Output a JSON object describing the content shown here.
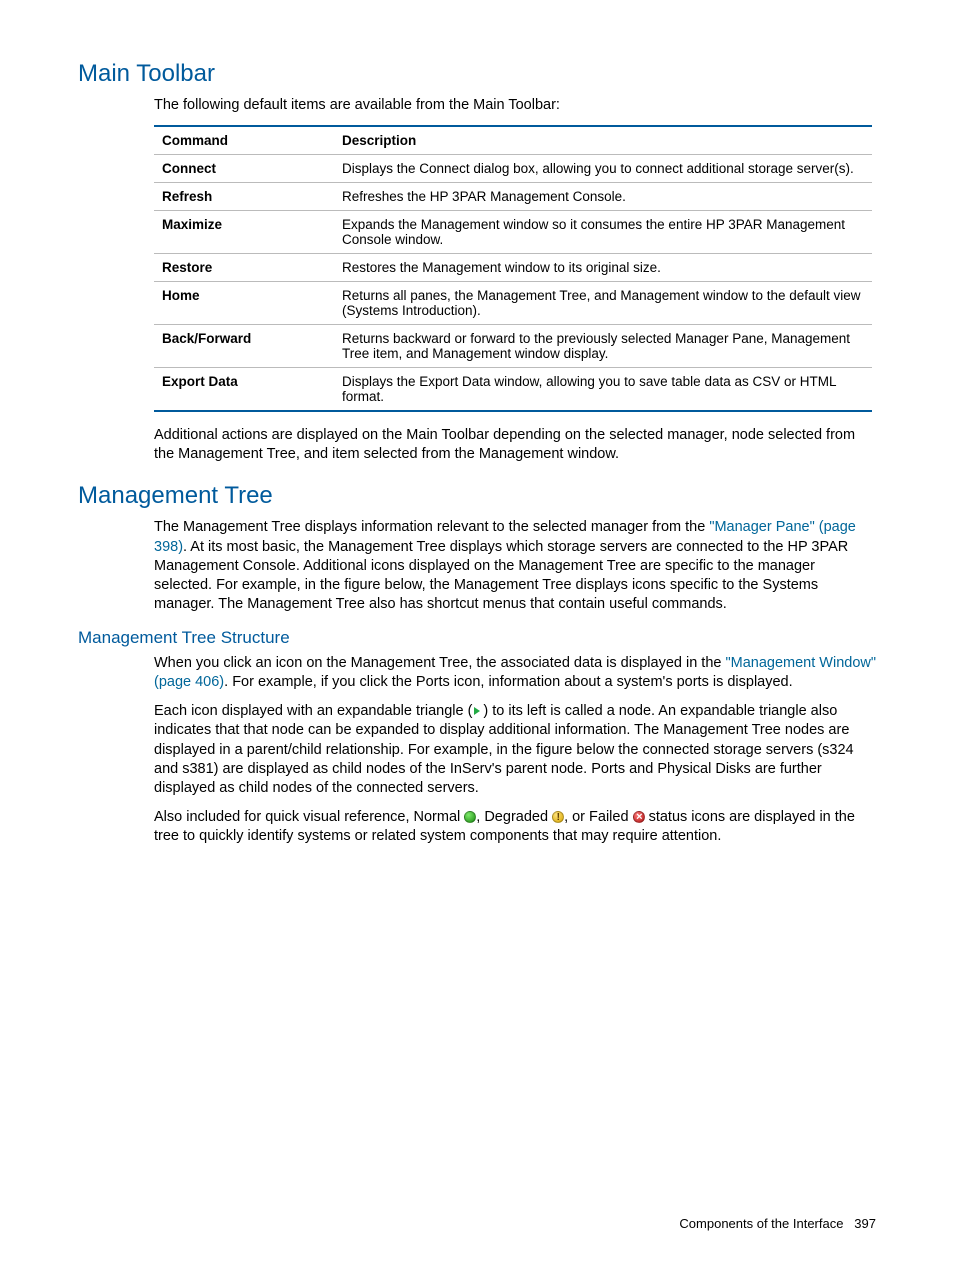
{
  "section1": {
    "title": "Main Toolbar",
    "intro": "The following default items are available from the Main Toolbar:",
    "table": {
      "headers": {
        "c1": "Command",
        "c2": "Description"
      },
      "rows": [
        {
          "cmd": "Connect",
          "desc": "Displays the Connect dialog box, allowing you to connect additional storage server(s)."
        },
        {
          "cmd": "Refresh",
          "desc": "Refreshes the HP 3PAR Management Console."
        },
        {
          "cmd": "Maximize",
          "desc": "Expands the Management window so it consumes the entire HP 3PAR Management Console window."
        },
        {
          "cmd": "Restore",
          "desc": "Restores the Management window to its original size."
        },
        {
          "cmd": "Home",
          "desc": "Returns all panes, the Management Tree, and Management window to the default view (Systems Introduction)."
        },
        {
          "cmd": "Back/Forward",
          "desc": "Returns backward or forward to the previously selected Manager Pane, Management Tree item, and Management window display."
        },
        {
          "cmd": "Export Data",
          "desc": "Displays the Export Data window, allowing you to save table data as CSV or HTML format."
        }
      ]
    },
    "after": "Additional actions are displayed on the Main Toolbar depending on the selected manager, node selected from the Management Tree, and item selected from the Management window."
  },
  "section2": {
    "title": "Management Tree",
    "p1a": "The Management Tree displays information relevant to the selected manager from the ",
    "p1link": "\"Manager Pane\" (page 398)",
    "p1b": ". At its most basic, the Management Tree displays which storage servers are connected to the HP 3PAR Management Console. Additional icons displayed on the Management Tree are specific to the manager selected. For example, in the figure below, the Management Tree displays icons specific to the Systems manager. The Management Tree also has shortcut menus that contain useful commands.",
    "sub": {
      "title": "Management Tree Structure",
      "p1a": "When you click an icon on the Management Tree, the associated data is displayed in the ",
      "p1link": "\"Management Window\" (page 406)",
      "p1b": ". For example, if you click the Ports icon, information about a system's ports is displayed.",
      "p2a": "Each icon displayed with an expandable triangle (",
      "p2b": ") to its left is called a node. An expandable triangle also indicates that that node can be expanded to display additional information. The Management Tree nodes are displayed in a parent/child relationship. For example, in the figure below the connected storage servers (s324 and s381) are displayed as child nodes of the InServ's parent node. Ports and Physical Disks are further displayed as child nodes of the connected servers.",
      "p3a": "Also included for quick visual reference, Normal ",
      "p3b": ", Degraded ",
      "p3c": ", or Failed ",
      "p3d": " status icons are displayed in the tree to quickly identify systems or related system components that may require attention."
    }
  },
  "footer": {
    "label": "Components of the Interface",
    "page": "397"
  }
}
